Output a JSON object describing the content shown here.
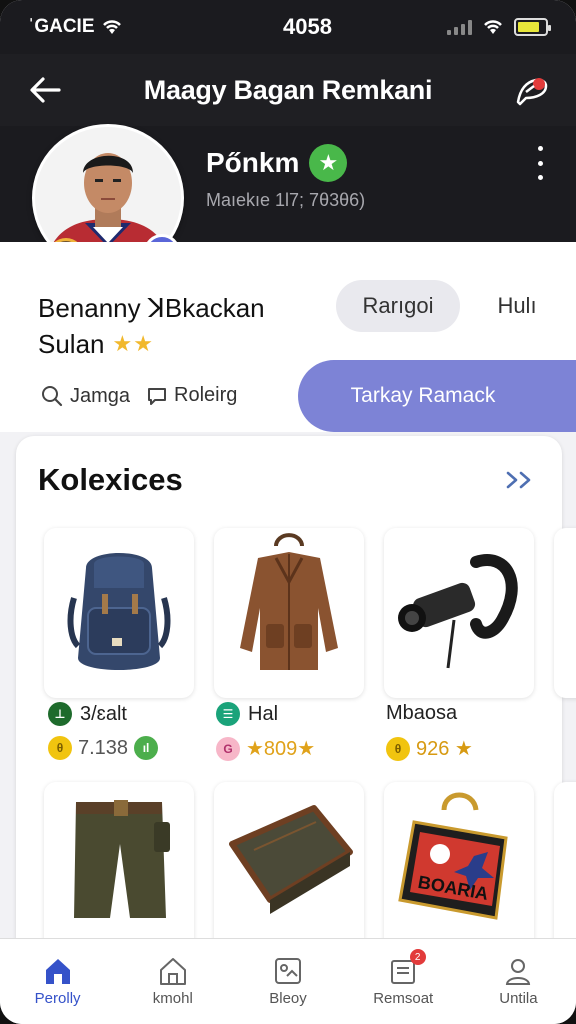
{
  "status_bar": {
    "carrier": "ˈGACIE",
    "time": "4058"
  },
  "app_bar": {
    "title": "Maagy Bagan Remkani"
  },
  "profile": {
    "name": "Pőnkm",
    "subtitle": "Maıekıe 1l7; 7θ3θ6)",
    "full_name_line1": "Benanny ꓘBkackan",
    "full_name_line2": "Sulan",
    "stars": "★★",
    "chip_active": "Rarıgoi",
    "chip_inactive": "Hulı",
    "link1": "Jamga",
    "link2": "Roleirg",
    "primary_button": "Tarkay Ramack"
  },
  "collection": {
    "title": "Kolexices",
    "items": [
      {
        "name": "3/ɛalt",
        "price": "7.138",
        "name_icon_color": "#1e6b2c",
        "price_icon_color": "#f1c40f"
      },
      {
        "name": "Hal",
        "price": "★809★",
        "name_icon_color": "#1aa37a",
        "price_icon_color": "#f06a8f"
      },
      {
        "name": "Mbaosa",
        "price": "926 ★",
        "name_icon_color": "",
        "price_icon_color": "#f1c40f"
      }
    ]
  },
  "nav": {
    "items": [
      {
        "label": "Perolly"
      },
      {
        "label": "kmohl"
      },
      {
        "label": "Bleoy"
      },
      {
        "label": "Remsoat"
      },
      {
        "label": "Untila"
      }
    ],
    "badge": "2"
  },
  "colors": {
    "accent": "#7d83d6",
    "active_nav": "#3552c9",
    "verified": "#49b84a"
  }
}
